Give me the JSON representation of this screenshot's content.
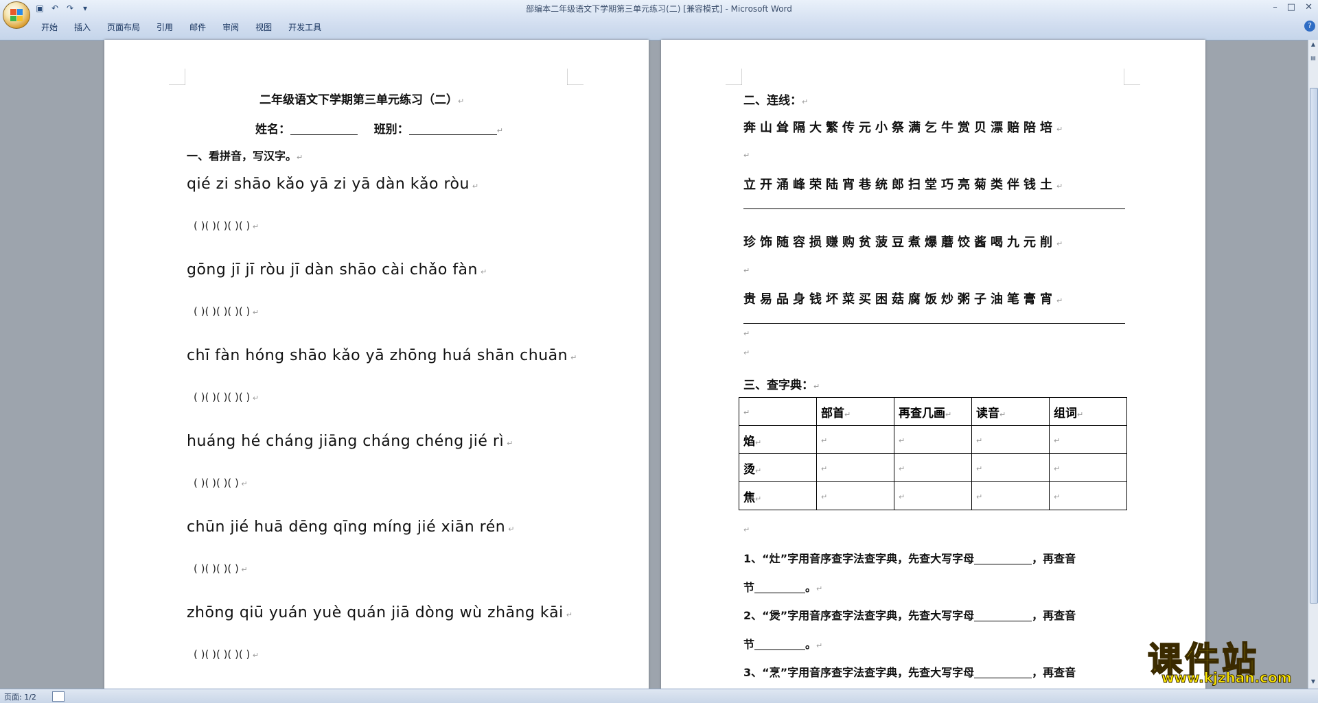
{
  "window": {
    "title": "部编本二年级语文下学期第三单元练习(二) [兼容模式] - Microsoft Word",
    "tabs": [
      "开始",
      "插入",
      "页面布局",
      "引用",
      "邮件",
      "审阅",
      "视图",
      "开发工具"
    ]
  },
  "status": {
    "page_label": "页面: 1/2"
  },
  "left_page": {
    "title": "二年级语文下学期第三单元练习（二）",
    "name_label": "姓名：",
    "class_label": "班别：",
    "section1": "一、看拼音，写汉字。",
    "rows": [
      {
        "pinyin": "qié  zi  shāo  kǎo  yā  zi   yā  dàn  kǎo  ròu",
        "parens": "(        )(        )(        )(        )(        )"
      },
      {
        "pinyin": "gōng  jī  jī  ròu  jī  dàn  shāo  cài  chǎo  fàn",
        "parens": "(        )(         )(        )(          )(          )"
      },
      {
        "pinyin": "chī fàn  hóng shāo kǎo yā zhōng huá shān chuān",
        "parens": "(        )(          )(       )(             )(          )"
      },
      {
        "pinyin": "huáng hé  cháng jiāng  cháng chéng   jié  rì",
        "parens": "(         )(              )(              )(         )"
      },
      {
        "pinyin": "chūn  jié  huā  dēng  qīng  míng  jié   xiān  rén",
        "parens": "(         )(          )(                    )(          )"
      },
      {
        "pinyin": "zhōng qiū  yuán yuè quán jiā dòng wù zhāng kāi",
        "parens": "(         )(           )(         )(         )(         )"
      }
    ]
  },
  "right_page": {
    "section2": "二、连线：",
    "lines": [
      "奔山耸隔大繁传元小祭满乞牛赏贝漂赔陪培",
      "立开涌峰荣陆宵巷统郎扫堂巧亮菊类伴钱土",
      "珍饰随容损赚购贫菠豆煮爆蘑饺酱喝九元削",
      "贵易品身钱坏菜买困菇腐饭炒粥子油笔膏宵"
    ],
    "section3": "三、查字典：",
    "table": {
      "headers": [
        "",
        "部首",
        "再查几画",
        "读音",
        "组词"
      ],
      "rows": [
        "焰",
        "烫",
        "焦"
      ]
    },
    "q1": "1、“灶”字用音序查字法查字典，先查大写字母",
    "q1_tail": "，再查音",
    "q1_end": "节",
    "q2": "2、“煲”字用音序查字法查字典，先查大写字母",
    "q2_tail": "，再查音",
    "q2_end": "节",
    "q3": "3、“烹”字用音序查字法查字典，先查大写字母",
    "q3_tail": "，再查音"
  },
  "watermark": {
    "text": "课件站",
    "url": "www.kjzhan.com"
  },
  "icons": {
    "office_button": "office-logo-icon",
    "save": "save-icon",
    "undo": "undo-icon",
    "redo": "redo-icon",
    "help": "help-icon"
  }
}
